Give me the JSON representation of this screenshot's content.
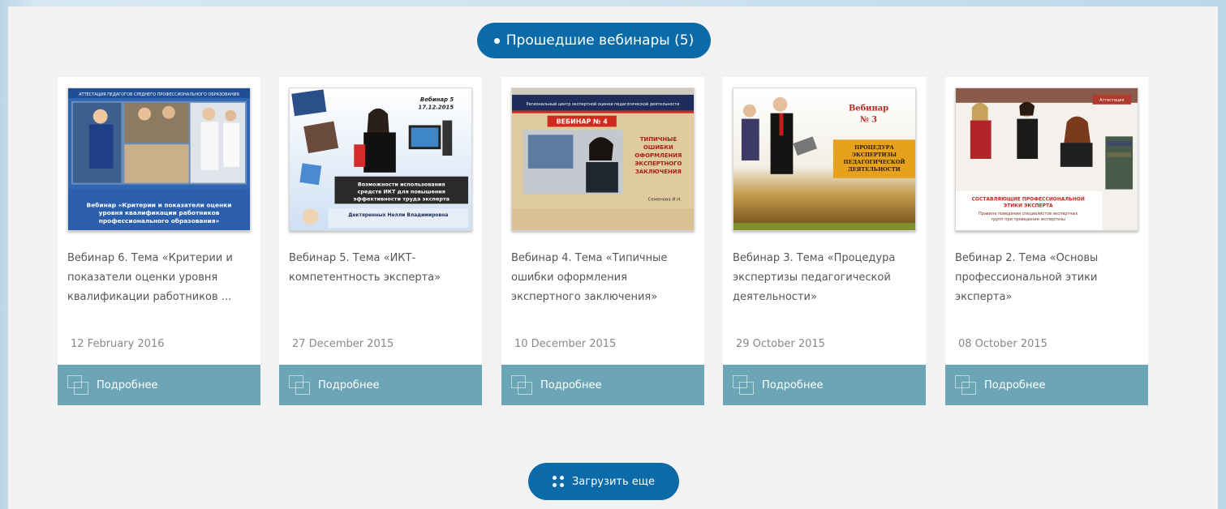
{
  "section": {
    "title": "Прошедшие вебинары (5)"
  },
  "cards": [
    {
      "title": "Вебинар 6. Тема «Критерии и показатели оценки уровня квалификации работников ...",
      "date": "12 February 2016",
      "more": "Подробнее",
      "thumb": {
        "header": "АТТЕСТАЦИЯ ПЕДАГОГОВ СРЕДНЕГО ПРОФЕССИОНАЛЬНОГО ОБРАЗОВАНИЯ",
        "caption": "Вебинар «Критерии и показатели оценки уровня квалификации работников профессионального образования»"
      }
    },
    {
      "title": "Вебинар 5. Тема «ИКТ-компетентность эксперта»",
      "date": "27 December 2015",
      "more": "Подробнее",
      "thumb": {
        "badge": "Вебинар 5",
        "badge_date": "17.12.2015",
        "caption": "Возможности использования средств ИКТ для повышения эффективности труда эксперта",
        "author": "Дектяренных Нелли Владимировна"
      }
    },
    {
      "title": "Вебинар 4. Тема «Типичные ошибки оформления экспертного заключения»",
      "date": "10 December 2015",
      "more": "Подробнее",
      "thumb": {
        "header": "Региональный центр экспертной оценки педагогической деятельности",
        "badge": "ВЕБИНАР № 4",
        "caption": "ТИПИЧНЫЕ ОШИБКИ ОФОРМЛЕНИЯ ЭКСПЕРТНОГО ЗАКЛЮЧЕНИЯ",
        "author": "Семенова И.Н."
      }
    },
    {
      "title": "Вебинар 3. Тема «Процедура экспертизы педагогической деятельности»",
      "date": "29 October 2015",
      "more": "Подробнее",
      "thumb": {
        "badge": "Вебинар",
        "badge_date": "№ 3",
        "caption": "ПРОЦЕДУРА ЭКСПЕРТИЗЫ ПЕДАГОГИЧЕСКОЙ ДЕЯТЕЛЬНОСТИ"
      }
    },
    {
      "title": "Вебинар 2. Тема «Основы профессиональной этики эксперта»",
      "date": "08 October 2015",
      "more": "Подробнее",
      "thumb": {
        "badge": "Аттестация",
        "caption": "СОСТАВЛЯЮЩИЕ ПРОФЕССИОНАЛЬНОЙ ЭТИКИ ЭКСПЕРТА",
        "subcaption": "Правила поведения специалистов экспертных групп при проведении экспертизы"
      }
    }
  ],
  "load_more": {
    "label": "Загрузить еще"
  },
  "colors": {
    "primary": "#0b6aa8",
    "card_footer": "#6ca6b6",
    "panel": "#f2f2f2"
  }
}
